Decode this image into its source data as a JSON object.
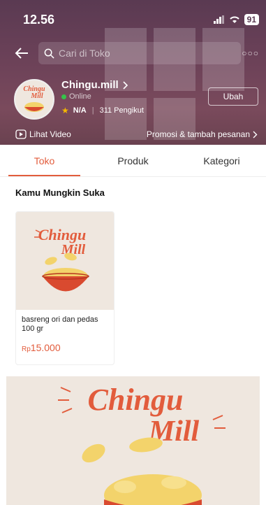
{
  "status": {
    "time": "12.56",
    "battery": "91"
  },
  "search": {
    "placeholder": "Cari di Toko"
  },
  "shop": {
    "name": "Chingu.mill",
    "status": "Online",
    "rating": "N/A",
    "followers": "311 Pengikut",
    "edit_label": "Ubah",
    "logo_line1": "Chingu",
    "logo_line2": "Mill"
  },
  "links": {
    "video": "Lihat Video",
    "promo": "Promosi & tambah pesanan"
  },
  "tabs": [
    {
      "label": "Toko",
      "active": true
    },
    {
      "label": "Produk",
      "active": false
    },
    {
      "label": "Kategori",
      "active": false
    }
  ],
  "section": {
    "title": "Kamu Mungkin Suka"
  },
  "products": [
    {
      "name": "basreng ori dan pedas 100 gr",
      "currency": "Rp",
      "price": "15.000",
      "logo_line1": "Chingu",
      "logo_line2": "Mill"
    }
  ],
  "banner": {
    "logo_line1": "Chingu",
    "logo_line2": "Mill"
  },
  "colors": {
    "accent": "#e25c3c",
    "header_bg": "#6b4158",
    "online": "#36c24a",
    "star": "#f5b800",
    "product_bg": "#efe7df"
  }
}
